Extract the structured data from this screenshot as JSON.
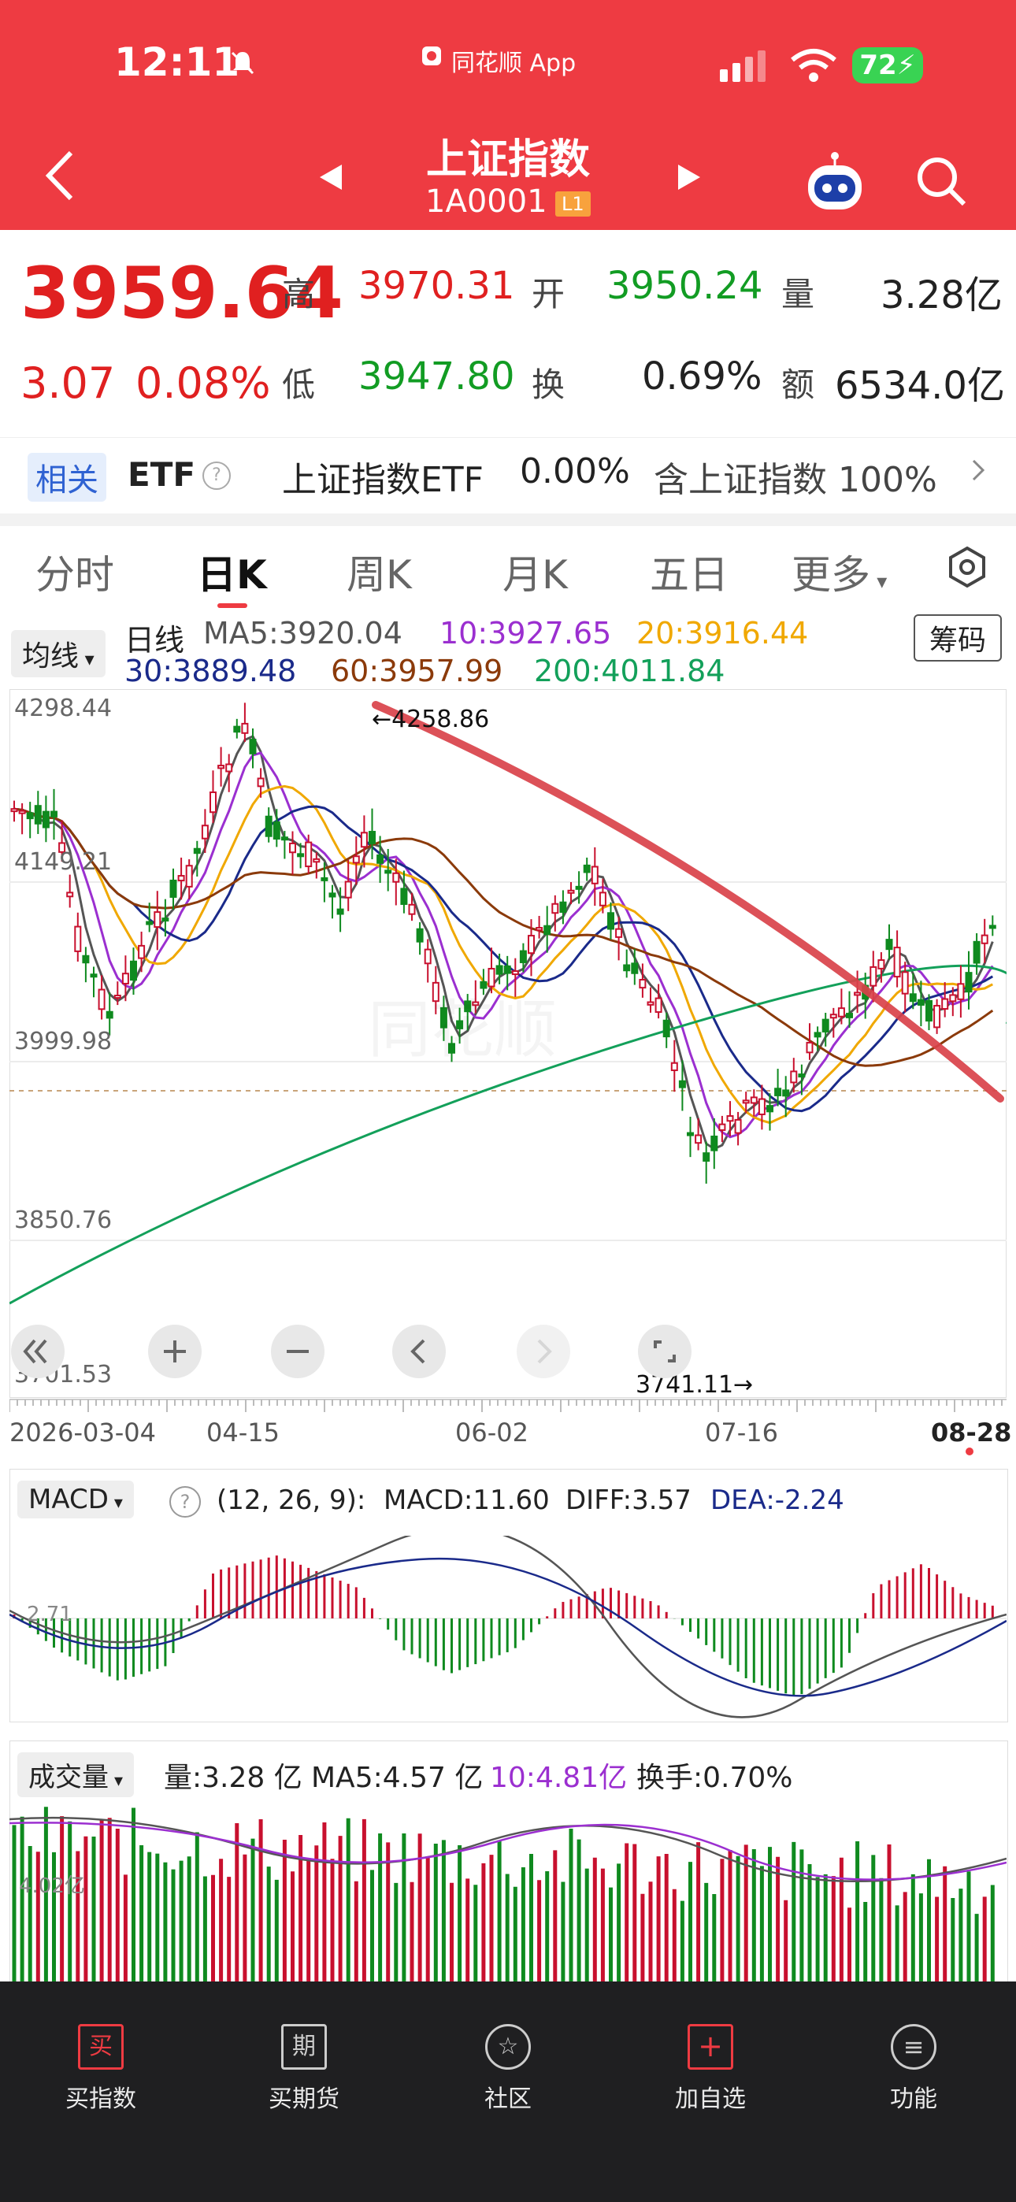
{
  "status": {
    "time": "12:11",
    "source_app": "同花顺 App",
    "battery": "72"
  },
  "header": {
    "title": "上证指数",
    "code": "1A0001",
    "code_badge": "L1"
  },
  "quote": {
    "price": "3959.64",
    "change": "3.07",
    "change_pct": "0.08%",
    "high_label": "高",
    "high": "3970.31",
    "open_label": "开",
    "open": "3950.24",
    "volume_label": "量",
    "volume": "3.28亿",
    "low_label": "低",
    "low": "3947.80",
    "turnover_label": "换",
    "turnover": "0.69%",
    "amount_label": "额",
    "amount": "6534.0亿"
  },
  "etf": {
    "tag": "相关",
    "label": "ETF",
    "help": "?",
    "name": "上证指数ETF",
    "pct": "0.00%",
    "holding": "含上证指数 100%"
  },
  "tabs": [
    "分时",
    "日K",
    "周K",
    "月K",
    "五日",
    "更多"
  ],
  "kline": {
    "indicator_select": "均线",
    "period": "日线",
    "ma5": "MA5:3920.04",
    "ma10": "10:3927.65",
    "ma20": "20:3916.44",
    "ma30": "30:3889.48",
    "ma60": "60:3957.99",
    "ma200": "200:4011.84",
    "chip_button": "筹码",
    "y_ticks": [
      "4298.44",
      "4149.21",
      "3999.98",
      "3850.76",
      "3701.53"
    ],
    "high_marker": "←4258.86",
    "low_marker": "3741.11→",
    "x_ticks": [
      "2026-03-04",
      "04-15",
      "06-02",
      "07-16",
      "08-28"
    ],
    "colors": {
      "up": "#c8102e",
      "down": "#0f8a1f",
      "ma5": "#555555",
      "ma10": "#9b2fd0",
      "ma20": "#f0a800",
      "ma30": "#1a2a8a",
      "ma60": "#8b3a0a",
      "ma200": "#13a05a",
      "trend": "#d9424a"
    }
  },
  "macd": {
    "select": "MACD",
    "help": "?",
    "params": "(12, 26, 9):",
    "macd": "MACD:11.60",
    "diff": "DIFF:3.57",
    "dea": "DEA:-2.24",
    "axis_label": "2.71"
  },
  "volume": {
    "select": "成交量",
    "vol": "量:3.28 亿",
    "ma5": "MA5:4.57 亿",
    "ma10": "10:4.81亿",
    "turnover": "换手:0.70%",
    "axis_label": "4.02亿"
  },
  "bottom_nav": [
    {
      "label": "买指数",
      "icon": "buy-icon",
      "glyph": "买"
    },
    {
      "label": "买期货",
      "icon": "futures-icon",
      "glyph": "期"
    },
    {
      "label": "社区",
      "icon": "community-icon",
      "glyph": "☆"
    },
    {
      "label": "加自选",
      "icon": "add-watchlist-icon",
      "glyph": "+"
    },
    {
      "label": "功能",
      "icon": "menu-icon",
      "glyph": "≡"
    }
  ]
}
